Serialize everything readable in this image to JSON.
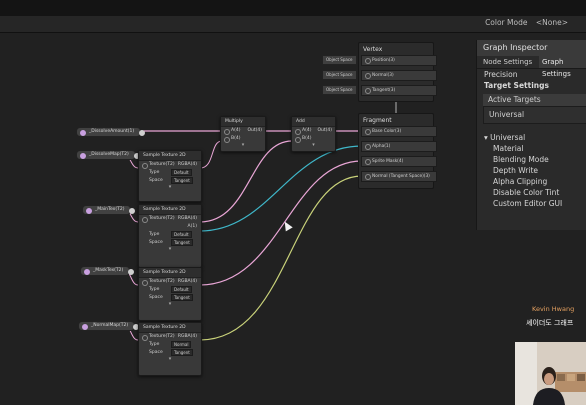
{
  "toolbar": {
    "color_mode_label": "Color Mode",
    "color_mode_value": "<None>"
  },
  "properties": [
    {
      "id": "p1",
      "label": "_DissolveAmount(1)"
    },
    {
      "id": "p2",
      "label": "_DissolveMap(T2)"
    },
    {
      "id": "p3",
      "label": "_MainTex(T2)"
    },
    {
      "id": "p4",
      "label": "_MaskTex(T2)"
    },
    {
      "id": "p5",
      "label": "_NormalMap(T2)"
    }
  ],
  "sampler_nodes": [
    {
      "title": "Sample Texture 2D",
      "in_label": "Texture(T2)",
      "out_label": "RGBA(4)",
      "type_label": "Type",
      "type_value": "Default",
      "space_label": "Space",
      "space_value": "Tangent"
    },
    {
      "title": "Sample Texture 2D",
      "in_label": "Texture(T2)",
      "out_label": "RGBA(4)",
      "out2_label": "A(1)",
      "type_label": "Type",
      "type_value": "Default",
      "space_label": "Space",
      "space_value": "Tangent"
    },
    {
      "title": "Sample Texture 2D",
      "in_label": "Texture(T2)",
      "out_label": "RGBA(4)",
      "type_label": "Type",
      "type_value": "Default",
      "space_label": "Space",
      "space_value": "Tangent"
    },
    {
      "title": "Sample Texture 2D",
      "in_label": "Texture(T2)",
      "out_label": "RGBA(4)",
      "type_label": "Type",
      "type_value": "Normal",
      "space_label": "Space",
      "space_value": "Tangent"
    }
  ],
  "multiply": {
    "title": "Multiply",
    "a": "A(4)",
    "b": "B(4)",
    "out": "Out(4)"
  },
  "add": {
    "title": "Add",
    "a": "A(4)",
    "b": "B(4)",
    "out": "Out(4)"
  },
  "vertex": {
    "title": "Vertex",
    "slots": [
      {
        "box": "Object Space",
        "label": "Position(3)"
      },
      {
        "box": "Object Space",
        "label": "Normal(3)"
      },
      {
        "box": "Object Space",
        "label": "Tangent(3)"
      }
    ]
  },
  "fragment": {
    "title": "Fragment",
    "slots": [
      "Base Color(3)",
      "Alpha(1)",
      "Sprite Mask(4)",
      "Normal (Tangent Space)(3)"
    ]
  },
  "inspector": {
    "title": "Graph Inspector",
    "tab_node": "Node Settings",
    "tab_graph": "Graph Settings",
    "precision": "Precision",
    "target_settings": "Target Settings",
    "active_targets": "Active Targets",
    "target_value": "Universal",
    "universal_header": "Universal",
    "options": [
      "Material",
      "Blending Mode",
      "Depth Write",
      "Alpha Clipping",
      "Disable Color Tint",
      "Custom Editor GUI"
    ]
  },
  "overlay": {
    "name": "Kevin Hwang",
    "subtitle": "셰이더도 그래프"
  },
  "colors": {
    "wire_pink": "#e9a6d6",
    "wire_cyan": "#3fb7c9",
    "wire_olive": "#c9d27a",
    "wire_gray": "#9a9a9a"
  }
}
